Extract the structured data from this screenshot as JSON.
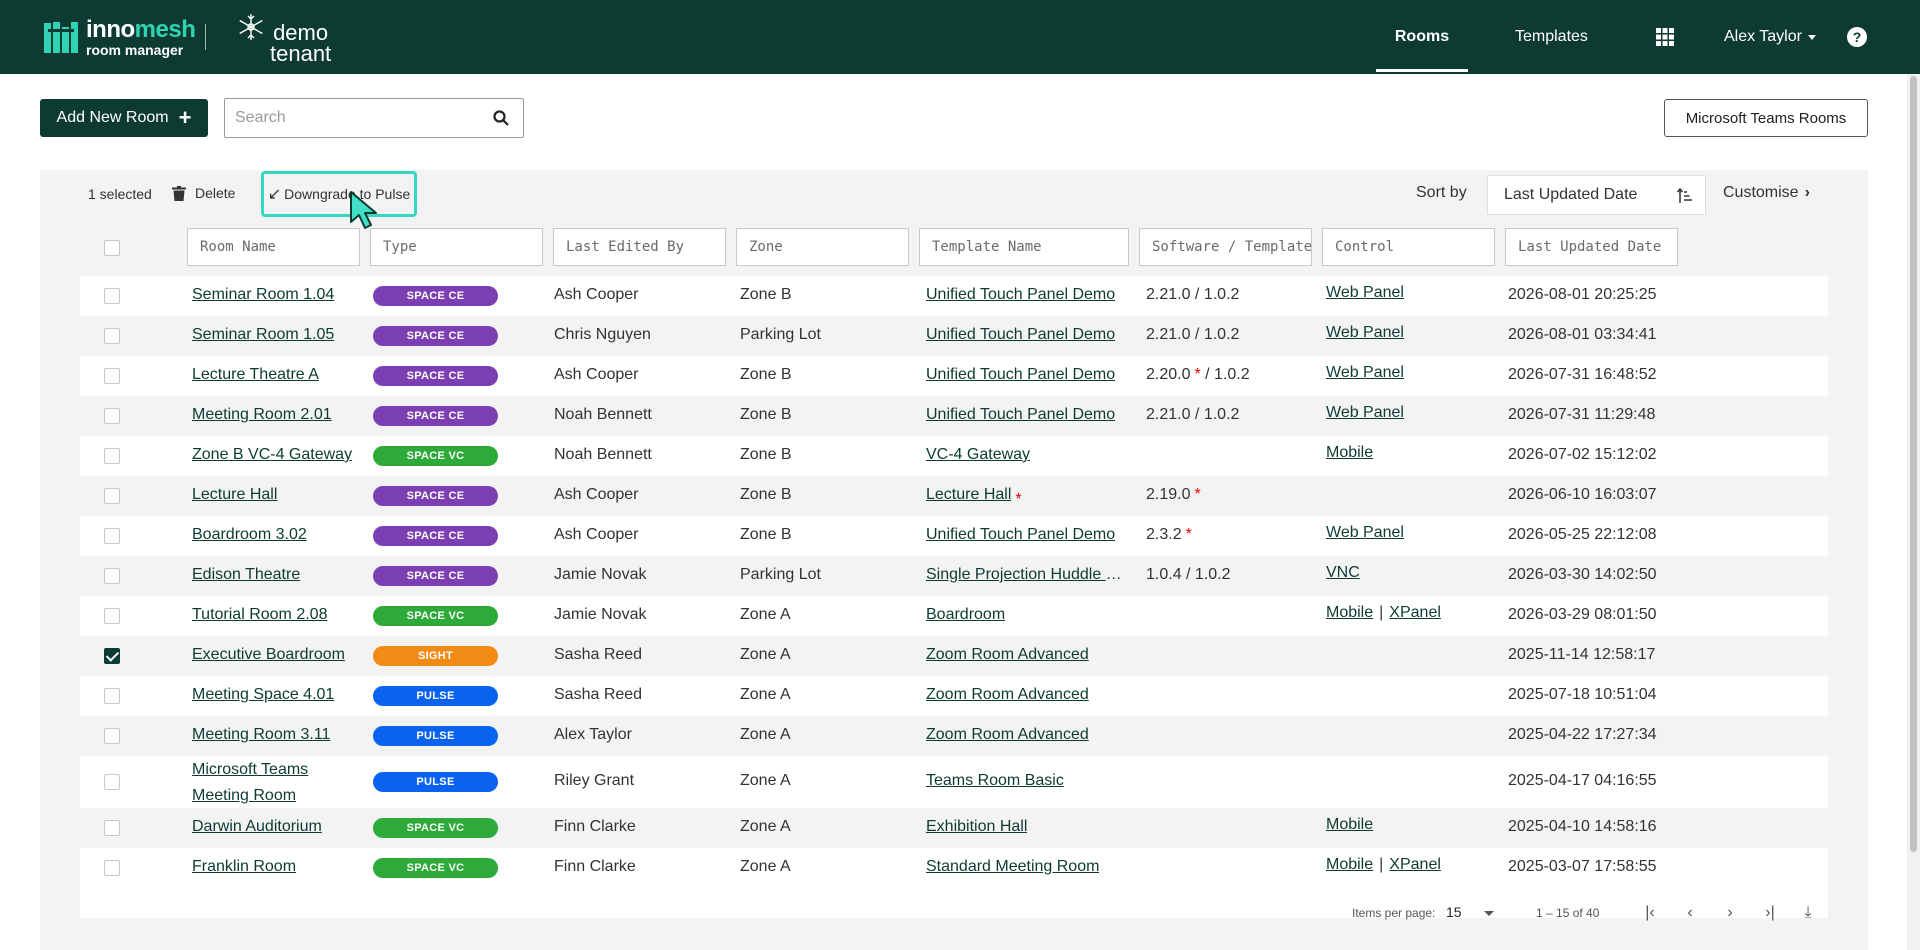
{
  "header": {
    "brand_part1": "inno",
    "brand_part2": "mesh",
    "brand_sub": "room manager",
    "tenant_line1": "demo",
    "tenant_line2": "tenant",
    "nav": {
      "rooms": "Rooms",
      "templates": "Templates",
      "user": "Alex Taylor",
      "help": "?"
    }
  },
  "toolbar": {
    "add_button": "Add New Room",
    "search_placeholder": "Search",
    "teams_button": "Microsoft Teams Rooms"
  },
  "selection": {
    "count": "1 selected",
    "delete": "Delete",
    "downgrade": "Downgrade to Pulse"
  },
  "sort": {
    "label": "Sort by",
    "value": "Last Updated Date",
    "customise": "Customise"
  },
  "columns": {
    "room_name": "Room Name",
    "type": "Type",
    "last_edited_by": "Last Edited By",
    "zone": "Zone",
    "template_name": "Template Name",
    "software": "Software / Template",
    "control": "Control",
    "last_updated": "Last Updated Date"
  },
  "badge_colors": {
    "SPACE CE": "#7b3fb2",
    "SPACE VC": "#2eaa3a",
    "SIGHT": "#f28a16",
    "PULSE": "#0a63f0"
  },
  "rows": [
    {
      "name": "Seminar Room 1.04",
      "type": "SPACE CE",
      "editor": "Ash Cooper",
      "zone": "Zone B",
      "template": "Unified Touch Panel Demo",
      "software": "2.21.0 / 1.0.2",
      "control": [
        "Web Panel"
      ],
      "date": "2026-08-01 20:25:25",
      "checked": false
    },
    {
      "name": "Seminar Room 1.05",
      "type": "SPACE CE",
      "editor": "Chris Nguyen",
      "zone": "Parking Lot",
      "template": "Unified Touch Panel Demo",
      "software": "2.21.0 / 1.0.2",
      "control": [
        "Web Panel"
      ],
      "date": "2026-08-01 03:34:41",
      "checked": false
    },
    {
      "name": "Lecture Theatre A",
      "type": "SPACE CE",
      "editor": "Ash Cooper",
      "zone": "Zone B",
      "template": "Unified Touch Panel Demo",
      "software": "2.20.0",
      "software_suffix": " / 1.0.2",
      "software_star": true,
      "control": [
        "Web Panel"
      ],
      "date": "2026-07-31 16:48:52",
      "checked": false
    },
    {
      "name": "Meeting Room 2.01",
      "type": "SPACE CE",
      "editor": "Noah Bennett",
      "zone": "Zone B",
      "template": "Unified Touch Panel Demo",
      "software": "2.21.0 / 1.0.2",
      "control": [
        "Web Panel"
      ],
      "date": "2026-07-31 11:29:48",
      "checked": false
    },
    {
      "name": "Zone B VC-4 Gateway",
      "type": "SPACE VC",
      "editor": "Noah Bennett",
      "zone": "Zone B",
      "template": "VC-4 Gateway",
      "software": "",
      "control": [
        "Mobile"
      ],
      "date": "2026-07-02 15:12:02",
      "checked": false
    },
    {
      "name": "Lecture Hall",
      "type": "SPACE CE",
      "editor": "Ash Cooper",
      "zone": "Zone B",
      "template": "Lecture Hall",
      "template_star": true,
      "software": "2.19.0",
      "software_star": true,
      "control": [],
      "date": "2026-06-10 16:03:07",
      "checked": false
    },
    {
      "name": "Boardroom 3.02",
      "type": "SPACE CE",
      "editor": "Ash Cooper",
      "zone": "Zone B",
      "template": "Unified Touch Panel Demo",
      "software": "2.3.2",
      "software_star": true,
      "control": [
        "Web Panel"
      ],
      "date": "2026-05-25 22:12:08",
      "checked": false
    },
    {
      "name": "Edison Theatre",
      "type": "SPACE CE",
      "editor": "Jamie Novak",
      "zone": "Parking Lot",
      "template": "Single Projection Huddle S...",
      "software": "1.0.4 / 1.0.2",
      "control": [
        "VNC"
      ],
      "date": "2026-03-30 14:02:50",
      "checked": false
    },
    {
      "name": "Tutorial Room 2.08",
      "type": "SPACE VC",
      "editor": "Jamie Novak",
      "zone": "Zone A",
      "template": "Boardroom",
      "software": "",
      "control": [
        "Mobile",
        "XPanel"
      ],
      "date": "2026-03-29 08:01:50",
      "checked": false
    },
    {
      "name": "Executive Boardroom",
      "type": "SIGHT",
      "editor": "Sasha Reed",
      "zone": "Zone A",
      "template": "Zoom Room Advanced",
      "software": "",
      "control": [],
      "date": "2025-11-14 12:58:17",
      "checked": true
    },
    {
      "name": "Meeting Space 4.01",
      "type": "PULSE",
      "editor": "Sasha Reed",
      "zone": "Zone A",
      "template": "Zoom Room Advanced",
      "software": "",
      "control": [],
      "date": "2025-07-18 10:51:04",
      "checked": false
    },
    {
      "name": "Meeting Room 3.11",
      "type": "PULSE",
      "editor": "Alex Taylor",
      "zone": "Zone A",
      "template": "Zoom Room Advanced",
      "software": "",
      "control": [],
      "date": "2025-04-22 17:27:34",
      "checked": false
    },
    {
      "name": "Microsoft Teams Meeting Room",
      "type": "PULSE",
      "editor": "Riley Grant",
      "zone": "Zone A",
      "template": "Teams Room Basic",
      "software": "",
      "control": [],
      "date": "2025-04-17 04:16:55",
      "checked": false,
      "tall": true
    },
    {
      "name": "Darwin Auditorium",
      "type": "SPACE VC",
      "editor": "Finn Clarke",
      "zone": "Zone A",
      "template": "Exhibition Hall",
      "software": "",
      "control": [
        "Mobile"
      ],
      "date": "2025-04-10 14:58:16",
      "checked": false
    },
    {
      "name": "Franklin Room",
      "type": "SPACE VC",
      "editor": "Finn Clarke",
      "zone": "Zone A",
      "template": "Standard Meeting Room",
      "software": "",
      "control": [
        "Mobile",
        "XPanel"
      ],
      "date": "2025-03-07 17:58:55",
      "checked": false
    }
  ],
  "pagination": {
    "items_label": "Items per page:",
    "items_value": "15",
    "range": "1 – 15 of 40"
  }
}
